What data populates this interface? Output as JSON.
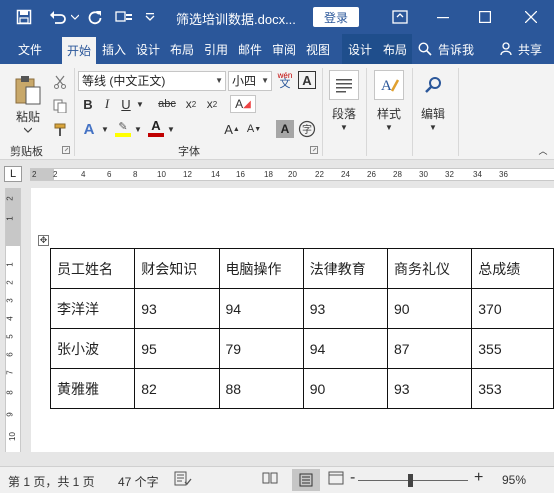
{
  "titlebar": {
    "doc_title": "筛选培训数据.docx...",
    "login": "登录",
    "icons": [
      "save-icon",
      "undo-icon",
      "redo-icon",
      "customize-icon",
      "ribbon-display-icon",
      "minimize-icon",
      "maximize-icon",
      "close-icon"
    ]
  },
  "tabs": {
    "file": "文件",
    "home": "开始",
    "insert": "插入",
    "design": "设计",
    "layout": "布局",
    "references": "引用",
    "mailings": "邮件",
    "review": "审阅",
    "view": "视图",
    "table_design": "设计",
    "table_layout": "布局",
    "tell_me": "告诉我",
    "share": "共享"
  },
  "ribbon": {
    "clipboard": {
      "paste": "粘贴",
      "group": "剪贴板"
    },
    "font": {
      "font_name": "等线 (中文正文)",
      "font_size": "小四",
      "phonetic": "wén",
      "border_char": "A",
      "group": "字体"
    },
    "paragraph": {
      "label": "段落"
    },
    "styles": {
      "label": "样式"
    },
    "editing": {
      "label": "编辑"
    }
  },
  "ruler": {
    "corner": "L",
    "h_ticks": [
      "2",
      "2",
      "4",
      "6",
      "8",
      "10",
      "12",
      "14",
      "16",
      "18",
      "20",
      "22",
      "24",
      "26",
      "28",
      "30",
      "32",
      "34",
      "36"
    ],
    "v_ticks": [
      "2",
      "1",
      "1",
      "2",
      "3",
      "4",
      "5",
      "6",
      "7",
      "8",
      "9",
      "10"
    ]
  },
  "table": {
    "headers": [
      "员工姓名",
      "财会知识",
      "电脑操作",
      "法律教育",
      "商务礼仪",
      "总成绩"
    ],
    "rows": [
      [
        "李洋洋",
        "93",
        "94",
        "93",
        "90",
        "370"
      ],
      [
        "张小波",
        "95",
        "79",
        "94",
        "87",
        "355"
      ],
      [
        "黄雅雅",
        "82",
        "88",
        "90",
        "93",
        "353"
      ]
    ]
  },
  "status": {
    "page": "第 1 页，共 1 页",
    "words": "47 个字",
    "zoom": "95%",
    "zoom_minus": "-",
    "zoom_plus": "+",
    "zoom_fraction": 0.475
  },
  "colors": {
    "brand": "#2b579a",
    "ribbon_bg": "#f3f3f3",
    "highlight": "#ffff00",
    "font_color": "#c00000"
  }
}
